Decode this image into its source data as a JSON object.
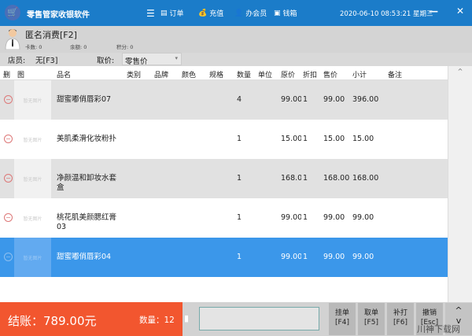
{
  "app": {
    "title": "零售管家收银软件",
    "datetime": "2020-06-10 08:53:21",
    "weekday": "星期三",
    "nav": [
      {
        "icon": "menu-icon",
        "label": ""
      },
      {
        "icon": "order-icon",
        "label": "订单"
      },
      {
        "icon": "moneybag-icon",
        "label": "充值"
      },
      {
        "icon": "user-icon",
        "label": "办会员"
      },
      {
        "icon": "cashbox-icon",
        "label": "钱箱"
      }
    ]
  },
  "customer": {
    "name": "匿名消费[F2]",
    "card_label": "卡数:",
    "card": "0",
    "balance_label": "余额:",
    "balance": "0",
    "points_label": "积分:",
    "points": "0"
  },
  "options": {
    "staff_label": "店员:",
    "staff": "无[F3]",
    "price_label": "取价:",
    "price_type": "零售价"
  },
  "table": {
    "headers": [
      "删",
      "图",
      "品名",
      "类别",
      "品牌",
      "颜色",
      "规格",
      "数量",
      "单位",
      "原价",
      "折扣",
      "售价",
      "小计",
      "备注"
    ],
    "no_image": "暂无图片",
    "rows": [
      {
        "name": "甜蜜嘟俏唇彩07",
        "qty": "4",
        "orig": "99.00",
        "disc": "1",
        "price": "99.00",
        "subtotal": "396.00"
      },
      {
        "name": "美肌柔滑化妆粉扑",
        "qty": "1",
        "orig": "15.00",
        "disc": "1",
        "price": "15.00",
        "subtotal": "15.00"
      },
      {
        "name": "净颜温和卸妆水套盒",
        "qty": "1",
        "orig": "168.00",
        "disc": "1",
        "price": "168.00",
        "subtotal": "168.00"
      },
      {
        "name": "桃花肌美颜腮红膏03",
        "qty": "1",
        "orig": "99.00",
        "disc": "1",
        "price": "99.00",
        "subtotal": "99.00"
      },
      {
        "name": "甜蜜嘟俏唇彩04",
        "qty": "1",
        "orig": "99.00",
        "disc": "1",
        "price": "99.00",
        "subtotal": "99.00"
      }
    ]
  },
  "footer": {
    "checkout": "结账：789.00元",
    "qty": "数量：12",
    "barcode": "",
    "buttons": [
      {
        "label": "挂单",
        "key": "[F4]"
      },
      {
        "label": "取单",
        "key": "[F5]"
      },
      {
        "label": "补打",
        "key": "[F6]"
      },
      {
        "label": "撤销",
        "key": "[Esc]"
      }
    ]
  },
  "watermark": "川神下载网"
}
